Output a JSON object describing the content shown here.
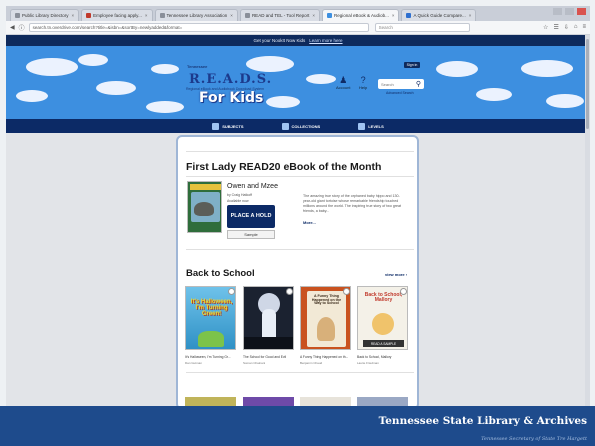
{
  "browser": {
    "tabs": [
      {
        "label": "Public Library Directory",
        "active": false
      },
      {
        "label": "Employee facing apply...",
        "active": false
      },
      {
        "label": "Tennessee Library Association",
        "active": false
      },
      {
        "label": "READ and TEL - Tool Report",
        "active": false
      },
      {
        "label": "Regional eBook & Audiob...",
        "active": true
      },
      {
        "label": "A Quick Guide Compare...",
        "active": false
      }
    ],
    "url": "search.tn.overdrive.com/search?title=&isbn=&sortBy=newlyadded&format=",
    "search_placeholder": "Search"
  },
  "site": {
    "notice_text": "Get your NookIt Now Kids",
    "notice_link": "Learn more here",
    "sign_in": "Sign in",
    "logo_small": "Tennessee",
    "logo": "R.E.A.D.S.",
    "logo_sub": "Regional eBook and Audiobook Download System",
    "logo_kids": "For Kids",
    "account": "Account",
    "help": "Help",
    "search_placeholder": "Search",
    "advanced": "Advanced Search",
    "nav": [
      "SUBJECTS",
      "COLLECTIONS",
      "LEVELS"
    ]
  },
  "featured": {
    "section_title": "First Lady READ20 eBook of the Month",
    "book_title": "Owen and Mzee",
    "author": "by Craig Hatkoff",
    "availability": "Available now",
    "place_hold": "PLACE A HOLD",
    "sample": "Sample",
    "description": "The amazing true story of the orphaned baby hippo and 130-year-old giant tortoise whose remarkable friendship touched millions around the world. The inspiring true story of two great friends, a baby...",
    "more": "More..."
  },
  "back_to_school": {
    "section_title": "Back to School",
    "view_more": "view more",
    "books": [
      {
        "cover_text": "It's Halloween, I'm Turning Green!",
        "title": "It's Halloween, I'm Turning Gr...",
        "author": "Dan Gutman"
      },
      {
        "cover_text": "",
        "title": "The School for Good and Evil",
        "author": "Soman Chainani"
      },
      {
        "cover_text": "A Funny Thing Happened on the Way to School",
        "title": "A Funny Thing Happened on th...",
        "author": "Benjamin Chaud"
      },
      {
        "cover_text": "Back to School, Mallory",
        "title": "Back to School, Mallory",
        "author": "Laurie Friedman",
        "badge": "READ A SAMPLE"
      }
    ]
  },
  "footer": {
    "brand": "Tennessee State Library & Archives",
    "sub": "Tennessee Secretary of State Tre Hargett"
  },
  "colors": {
    "navy": "#0c2a66",
    "sky": "#3d8fe0",
    "footer": "#1e4b8c"
  }
}
